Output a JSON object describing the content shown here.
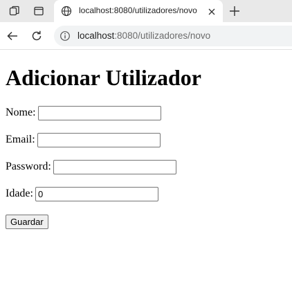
{
  "browser": {
    "tab": {
      "title": "localhost:8080/utilizadores/novo"
    },
    "address": {
      "host": "localhost",
      "rest": ":8080/utilizadores/novo"
    },
    "icons": {
      "workspaces": "workspaces-icon",
      "tab_actions": "tab-actions-icon",
      "favicon": "globe-icon",
      "close": "close-icon",
      "new_tab": "plus-icon",
      "back": "back-arrow-icon",
      "reload": "reload-icon",
      "site_info": "info-icon"
    }
  },
  "page": {
    "heading": "Adicionar Utilizador",
    "form": {
      "name_label": "Nome:",
      "name_value": "",
      "email_label": "Email:",
      "email_value": "",
      "password_label": "Password:",
      "password_value": "",
      "age_label": "Idade:",
      "age_value": "0",
      "submit_label": "Guardar"
    }
  }
}
